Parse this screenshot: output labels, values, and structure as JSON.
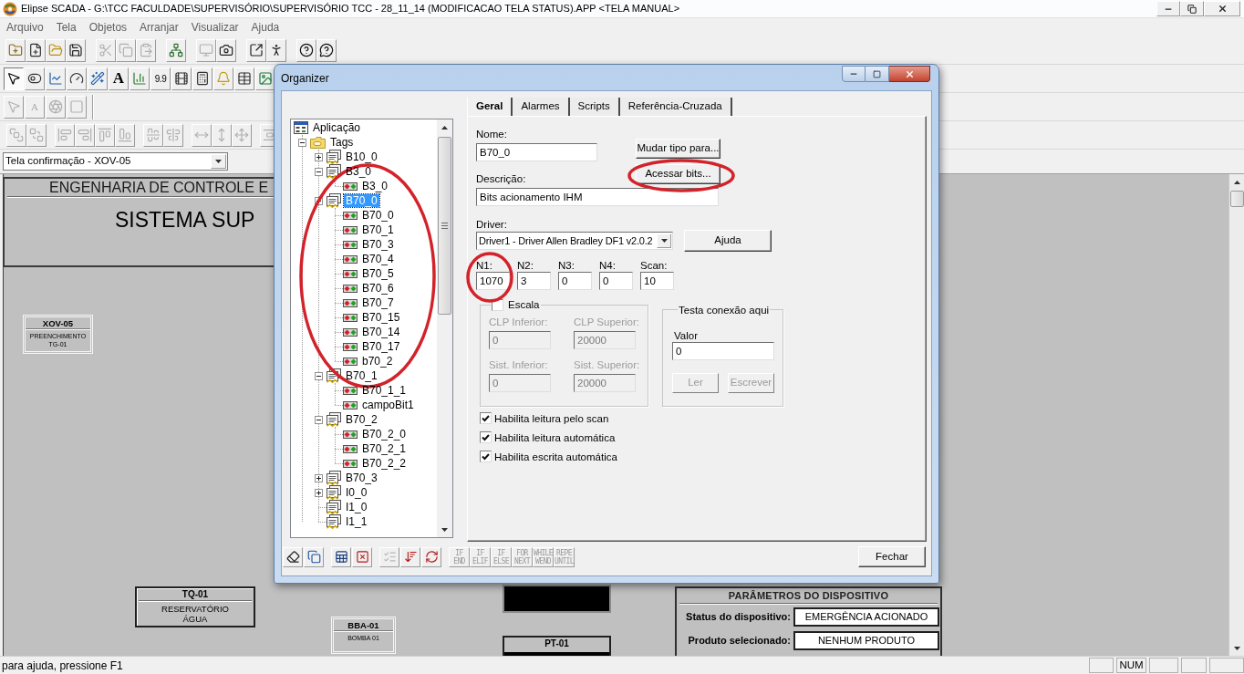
{
  "window": {
    "title": "Elipse SCADA - G:\\TCC FACULDADE\\SUPERVISÓRIO\\SUPERVISÓRIO TCC - 28_11_14 (MODIFICACAO TELA STATUS).APP <TELA MANUAL>"
  },
  "menu": [
    "Arquivo",
    "Tela",
    "Objetos",
    "Arranjar",
    "Visualizar",
    "Ajuda"
  ],
  "toolbars": [
    {
      "groups": [
        [
          {
            "kind": "new-project",
            "disabled": false
          },
          {
            "kind": "new-screen",
            "disabled": false
          },
          {
            "kind": "open",
            "disabled": false
          },
          {
            "kind": "save",
            "disabled": false
          }
        ],
        [
          {
            "kind": "cut",
            "disabled": true
          },
          {
            "kind": "copy",
            "disabled": true
          },
          {
            "kind": "paste",
            "disabled": true
          }
        ],
        [
          {
            "kind": "organizer",
            "disabled": false
          }
        ],
        [
          {
            "kind": "screen-image",
            "disabled": true
          },
          {
            "kind": "camera",
            "disabled": false
          }
        ],
        [
          {
            "kind": "run",
            "disabled": false
          },
          {
            "kind": "run-figure",
            "disabled": false
          }
        ],
        [
          {
            "kind": "help",
            "disabled": false
          },
          {
            "kind": "context-help",
            "disabled": false
          }
        ]
      ]
    },
    {
      "groups": [
        [
          {
            "kind": "pointer",
            "selected": true
          },
          {
            "kind": "button-tool",
            "selected": false
          },
          {
            "kind": "trend",
            "selected": false
          },
          {
            "kind": "gauge",
            "selected": false
          },
          {
            "kind": "wand",
            "selected": false
          },
          {
            "kind": "text",
            "label": "A",
            "selected": false
          },
          {
            "kind": "bar",
            "selected": false
          },
          {
            "kind": "display",
            "label": "9.9",
            "selected": false
          },
          {
            "kind": "film",
            "selected": false
          },
          {
            "kind": "setpoint",
            "selected": false
          },
          {
            "kind": "alarm",
            "selected": false
          },
          {
            "kind": "table",
            "selected": false
          },
          {
            "kind": "picture",
            "selected": false
          }
        ]
      ]
    },
    {
      "groups": [
        [
          {
            "kind": "pointer",
            "disabled": true
          },
          {
            "kind": "text",
            "label": "A",
            "disabled": true
          },
          {
            "kind": "aperture",
            "disabled": true
          },
          {
            "kind": "shape",
            "disabled": true
          }
        ]
      ]
    },
    {
      "groups": [
        [
          {
            "kind": "bring-front",
            "disabled": true
          },
          {
            "kind": "send-back",
            "disabled": true
          }
        ],
        [
          {
            "kind": "align-left",
            "disabled": true
          },
          {
            "kind": "align-right",
            "disabled": true
          },
          {
            "kind": "align-top",
            "disabled": true
          },
          {
            "kind": "align-bottom",
            "disabled": true
          }
        ],
        [
          {
            "kind": "center-h",
            "disabled": true
          },
          {
            "kind": "center-v",
            "disabled": true
          }
        ],
        [
          {
            "kind": "same-width",
            "disabled": true
          },
          {
            "kind": "same-height",
            "disabled": true
          },
          {
            "kind": "same-size",
            "disabled": true
          }
        ],
        [
          {
            "kind": "space-v",
            "disabled": true
          }
        ]
      ]
    }
  ],
  "screen_selector": {
    "value": "Tela confirmação - XOV-05"
  },
  "canvas": {
    "header": {
      "line_1": "ENGENHARIA DE CONTROLE E",
      "line_2": "SISTEMA SUP"
    },
    "objects": [
      {
        "kind": "tag-button",
        "title": "XOV-05",
        "description": "PREENCHIMENTO TG-01"
      },
      {
        "kind": "equipment",
        "title": "TQ-01",
        "description": "RESERVATÓRIO ÁGUA"
      },
      {
        "kind": "tag-button",
        "title": "BBA-01",
        "description": "BOMBA 01"
      },
      {
        "kind": "display"
      },
      {
        "kind": "instrument",
        "title": "PT-01"
      },
      {
        "kind": "parameters",
        "title": "PARÂMETROS DO DISPOSITIVO",
        "rows": [
          {
            "label": "Status do dispositivo:",
            "value": "EMERGÊNCIA ACIONADO"
          },
          {
            "label": "Produto selecionado:",
            "value": "NENHUM PRODUTO"
          }
        ]
      }
    ]
  },
  "organizer": {
    "title": "Organizer",
    "tree": [
      {
        "label": "Aplicação",
        "kind": "application",
        "selected": false,
        "children": [
          {
            "label": "Tags",
            "kind": "folder",
            "expanded": true,
            "selected": false,
            "children": [
              {
                "label": "B10_0",
                "kind": "block",
                "expanded": false,
                "selected": false
              },
              {
                "label": "B3_0",
                "kind": "block",
                "expanded": true,
                "selected": false,
                "children": [
                  {
                    "label": "B3_0",
                    "kind": "bit",
                    "selected": false
                  }
                ]
              },
              {
                "label": "B70_0",
                "kind": "block",
                "expanded": true,
                "selected": true,
                "children": [
                  {
                    "label": "B70_0",
                    "kind": "bit",
                    "selected": false
                  },
                  {
                    "label": "B70_1",
                    "kind": "bit",
                    "selected": false
                  },
                  {
                    "label": "B70_3",
                    "kind": "bit",
                    "selected": false
                  },
                  {
                    "label": "B70_4",
                    "kind": "bit",
                    "selected": false
                  },
                  {
                    "label": "B70_5",
                    "kind": "bit",
                    "selected": false
                  },
                  {
                    "label": "B70_6",
                    "kind": "bit",
                    "selected": false
                  },
                  {
                    "label": "B70_7",
                    "kind": "bit",
                    "selected": false
                  },
                  {
                    "label": "B70_15",
                    "kind": "bit",
                    "selected": false
                  },
                  {
                    "label": "B70_14",
                    "kind": "bit",
                    "selected": false
                  },
                  {
                    "label": "B70_17",
                    "kind": "bit",
                    "selected": false
                  },
                  {
                    "label": "b70_2",
                    "kind": "bit",
                    "selected": false
                  }
                ]
              },
              {
                "label": "B70_1",
                "kind": "block",
                "expanded": true,
                "selected": false,
                "children": [
                  {
                    "label": "B70_1_1",
                    "kind": "bit",
                    "selected": false
                  },
                  {
                    "label": "campoBit1",
                    "kind": "bit",
                    "selected": false
                  }
                ]
              },
              {
                "label": "B70_2",
                "kind": "block",
                "expanded": true,
                "selected": false,
                "children": [
                  {
                    "label": "B70_2_0",
                    "kind": "bit",
                    "selected": false
                  },
                  {
                    "label": "B70_2_1",
                    "kind": "bit",
                    "selected": false
                  },
                  {
                    "label": "B70_2_2",
                    "kind": "bit",
                    "selected": false
                  }
                ]
              },
              {
                "label": "B70_3",
                "kind": "block",
                "expanded": false,
                "selected": false
              },
              {
                "label": "I0_0",
                "kind": "block",
                "expanded": false,
                "selected": false
              },
              {
                "label": "I1_0",
                "kind": "block",
                "selected": false
              },
              {
                "label": "I1_1",
                "kind": "block",
                "selected": false
              }
            ]
          }
        ]
      }
    ],
    "tabs": [
      {
        "label": "Geral",
        "selected": true
      },
      {
        "label": "Alarmes",
        "selected": false
      },
      {
        "label": "Scripts",
        "selected": false
      },
      {
        "label": "Referência-Cruzada",
        "selected": false
      }
    ],
    "form": {
      "name": {
        "label": "Nome:",
        "value": "B70_0"
      },
      "change_type_button": "Mudar tipo para...",
      "access_bits_button": "Acessar bits...",
      "description": {
        "label": "Descrição:",
        "value": "Bits acionamento IHM"
      },
      "driver": {
        "label": "Driver:",
        "value": "Driver1 - Driver Allen Bradley DF1 v2.0.2"
      },
      "help_button": "Ajuda",
      "addresses": [
        {
          "label": "N1:",
          "value": "1070"
        },
        {
          "label": "N2:",
          "value": "3"
        },
        {
          "label": "N3:",
          "value": "0"
        },
        {
          "label": "N4:",
          "value": "0"
        },
        {
          "label": "Scan:",
          "value": "10"
        }
      ],
      "scale": {
        "label": "Escala",
        "checked": false,
        "fields": [
          {
            "label": "CLP Inferior:",
            "value": "0",
            "disabled": true
          },
          {
            "label": "CLP Superior:",
            "value": "20000",
            "disabled": true
          },
          {
            "label": "Sist. Inferior:",
            "value": "0",
            "disabled": true
          },
          {
            "label": "Sist. Superior:",
            "value": "20000",
            "disabled": true
          }
        ]
      },
      "connection_test": {
        "label": "Testa conexão aqui",
        "value_label": "Valor",
        "value": "0",
        "buttons": [
          {
            "label": "Ler",
            "disabled": true
          },
          {
            "label": "Escrever",
            "disabled": true
          }
        ]
      },
      "options": [
        {
          "label": "Habilita leitura pelo scan",
          "checked": true
        },
        {
          "label": "Habilita leitura automática",
          "checked": true
        },
        {
          "label": "Habilita escrita automática",
          "checked": true
        }
      ]
    },
    "toolbar": {
      "groups": [
        [
          {
            "kind": "eraser",
            "disabled": false
          },
          {
            "kind": "copy",
            "disabled": false
          }
        ],
        [
          {
            "kind": "table",
            "disabled": false
          },
          {
            "kind": "table-delete",
            "disabled": false
          }
        ],
        [
          {
            "kind": "validate",
            "disabled": true
          },
          {
            "kind": "sort",
            "disabled": false
          },
          {
            "kind": "refresh",
            "disabled": false
          }
        ]
      ]
    },
    "script_buttons": [
      {
        "lines": [
          "IF",
          "END"
        ],
        "disabled": true
      },
      {
        "lines": [
          "IF",
          "ELIF"
        ],
        "disabled": true
      },
      {
        "lines": [
          "IF",
          "ELSE"
        ],
        "disabled": true
      },
      {
        "lines": [
          "FOR",
          "NEXT"
        ],
        "disabled": true
      },
      {
        "lines": [
          "WHILE",
          "WEND"
        ],
        "disabled": true
      },
      {
        "lines": [
          "REPE",
          "UNTIL"
        ],
        "disabled": true
      }
    ],
    "close_button": "Fechar"
  },
  "annotations": [
    {
      "kind": "ellipse"
    },
    {
      "kind": "ellipse"
    },
    {
      "kind": "ellipse"
    }
  ],
  "status_bar": {
    "hint": "para ajuda, pressione F1",
    "indicator": "NUM"
  }
}
